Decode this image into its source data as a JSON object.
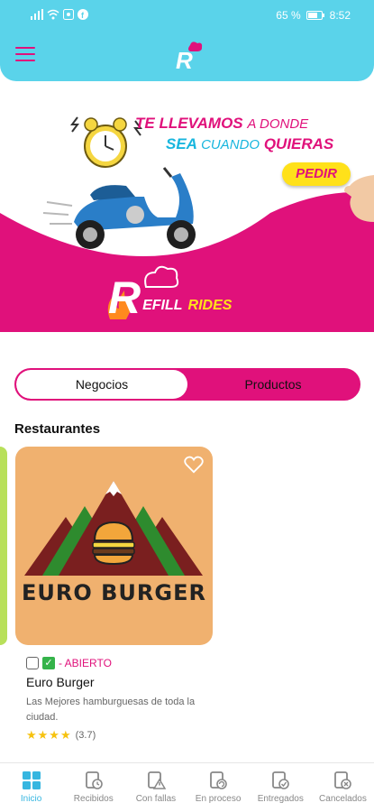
{
  "status_bar": {
    "battery": "65 %",
    "time": "8:52"
  },
  "banner": {
    "headline_part1": "TE LLEVAMOS",
    "headline_part2": "A DONDE",
    "headline_part3": "SEA",
    "headline_part4": "CUANDO",
    "headline_part5": "QUIERAS",
    "cta_label": "PEDIR",
    "brand_letter": "R",
    "brand_word1": "EFILL",
    "brand_word2": "RIDES"
  },
  "segments": {
    "left_label": "Negocios",
    "right_label": "Productos",
    "active": "Negocios"
  },
  "section_title": "Restaurantes",
  "restaurant": {
    "logo_text": "EURO BURGER",
    "status": "- ABIERTO",
    "name": "Euro Burger",
    "description": "Las Mejores hamburguesas de toda la ciudad.",
    "stars": "★★★★",
    "rating": "(3.7)"
  },
  "bottom_nav": {
    "items": [
      {
        "label": "Inicio",
        "icon": "home-grid-icon",
        "active": true
      },
      {
        "label": "Recibidos",
        "icon": "clipboard-clock-icon"
      },
      {
        "label": "Con fallas",
        "icon": "clipboard-warning-icon"
      },
      {
        "label": "En proceso",
        "icon": "clipboard-refresh-icon"
      },
      {
        "label": "Entregados",
        "icon": "clipboard-check-icon"
      },
      {
        "label": "Cancelados",
        "icon": "clipboard-cancel-icon"
      }
    ]
  },
  "colors": {
    "primary": "#5ad3ea",
    "accent": "#e0117b",
    "yellow": "#ffe11a"
  }
}
